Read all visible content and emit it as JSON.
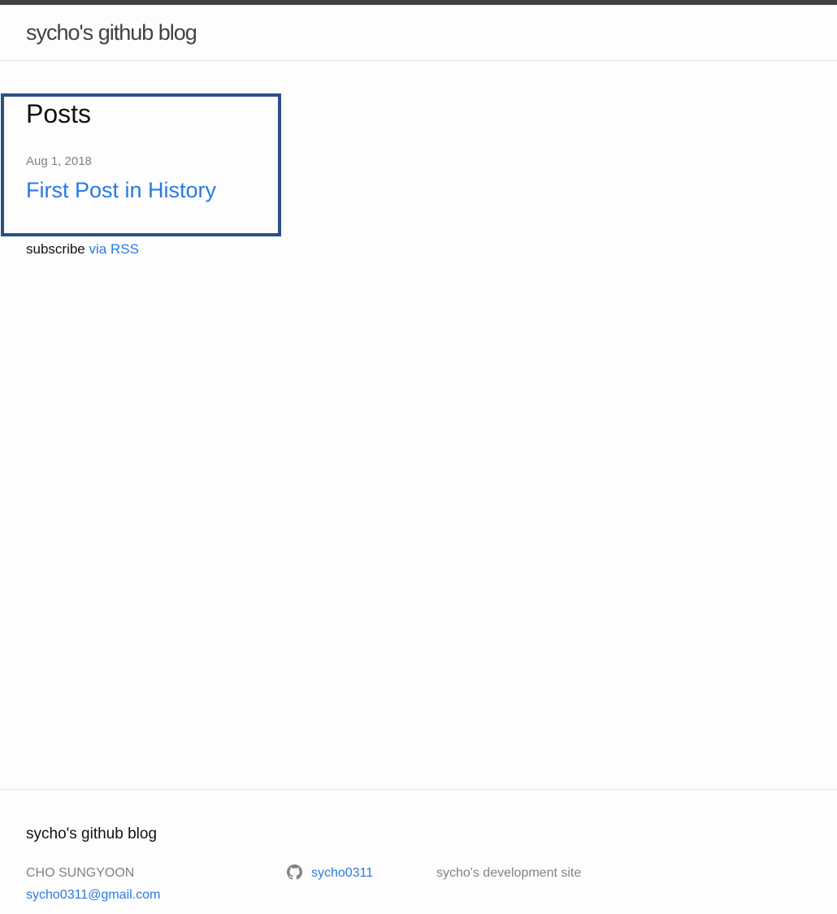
{
  "header": {
    "site_title": "sycho's github blog"
  },
  "main": {
    "heading": "Posts",
    "posts": [
      {
        "date": "Aug 1, 2018",
        "title": "First Post in History"
      }
    ],
    "rss": {
      "prefix": "subscribe",
      "link_label": "via RSS"
    }
  },
  "footer": {
    "heading": "sycho's github blog",
    "name": "CHO SUNGYOON",
    "email": "sycho0311@gmail.com",
    "github_username": "sycho0311",
    "description": "sycho's development site"
  },
  "theme": {
    "top_bar_color": "#424242",
    "link_color": "#2a7ae2",
    "highlight_border_color": "#2c4f86",
    "muted_text_color": "#828282"
  },
  "icons": {
    "github": "github-icon"
  }
}
